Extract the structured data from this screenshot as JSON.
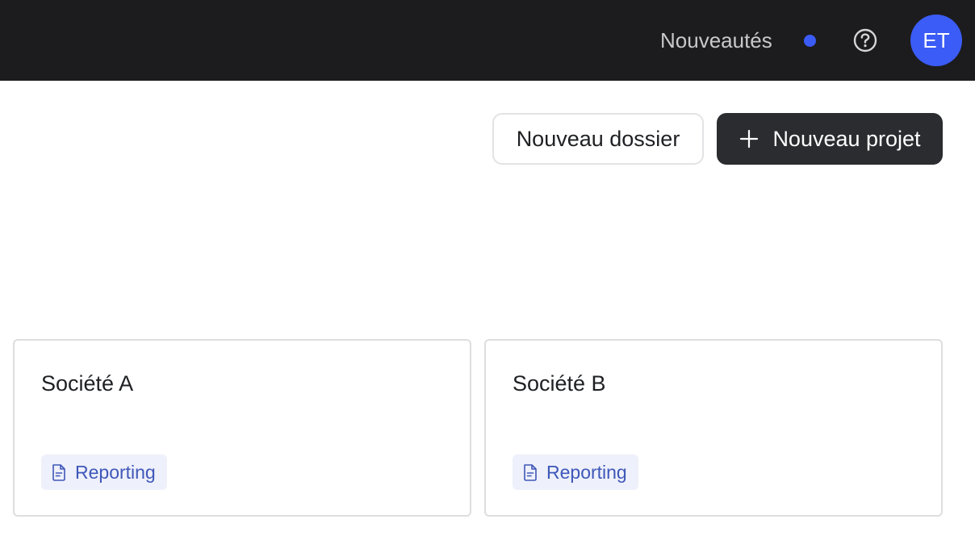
{
  "header": {
    "news_label": "Nouveautés",
    "help_icon": "help-circle-icon",
    "avatar_initials": "ET",
    "accent_color": "#3b5cf6"
  },
  "actions": {
    "new_folder_label": "Nouveau dossier",
    "new_project_label": "Nouveau projet",
    "new_project_icon": "plus-icon"
  },
  "projects": [
    {
      "title": "Société A",
      "tag": "Reporting",
      "tag_icon": "document-icon"
    },
    {
      "title": "Société B",
      "tag": "Reporting",
      "tag_icon": "document-icon"
    }
  ]
}
